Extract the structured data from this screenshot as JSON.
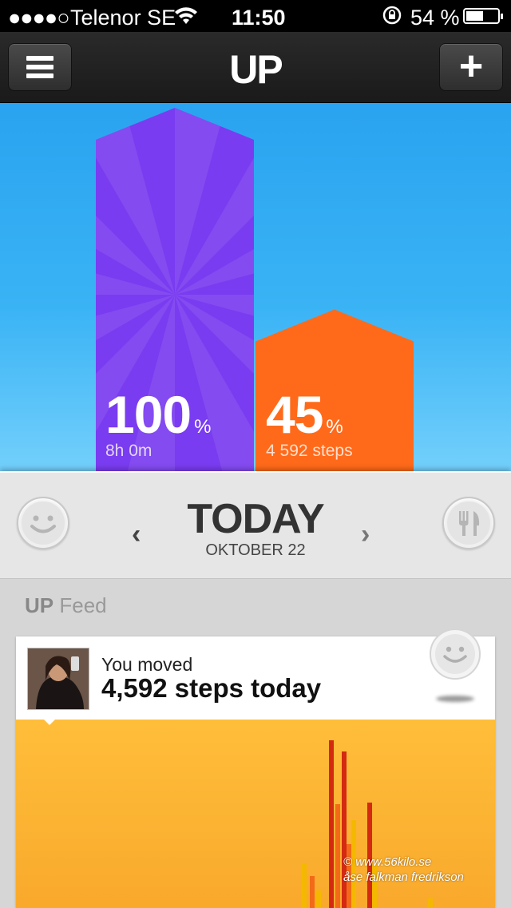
{
  "status_bar": {
    "signal": "●●●●○",
    "carrier": "Telenor SE",
    "wifi_icon": "wifi-icon",
    "time": "11:50",
    "rotation_lock_icon": "rotation-lock-icon",
    "battery_text": "54 %",
    "battery_level": 0.54
  },
  "nav": {
    "menu_icon": "hamburger-menu-icon",
    "title": "UP",
    "add_label": "+"
  },
  "summary": {
    "sleep": {
      "percent": "100",
      "percent_sign": "%",
      "detail": "8h 0m",
      "level": 1.0,
      "color": "#7a3cf0"
    },
    "move": {
      "percent": "45",
      "percent_sign": "%",
      "detail": "4 592 steps",
      "level": 0.45,
      "color": "#ff6a1a"
    }
  },
  "day": {
    "title": "TODAY",
    "date": "OKTOBER 22",
    "prev_label": "‹",
    "next_label": "›",
    "mood_icon": "smiley-face-icon",
    "food_icon": "fork-knife-icon"
  },
  "feed": {
    "heading_brand": "UP",
    "heading_text": "Feed",
    "card": {
      "line1": "You moved",
      "line2": "4,592 steps today",
      "mood_icon": "smiley-face-icon"
    },
    "activity_colors": [
      "#d42a12",
      "#f26a18",
      "#f5b800"
    ]
  },
  "watermark": {
    "line1": "© www.56kilo.se",
    "line2": "åse falkman fredrikson"
  }
}
